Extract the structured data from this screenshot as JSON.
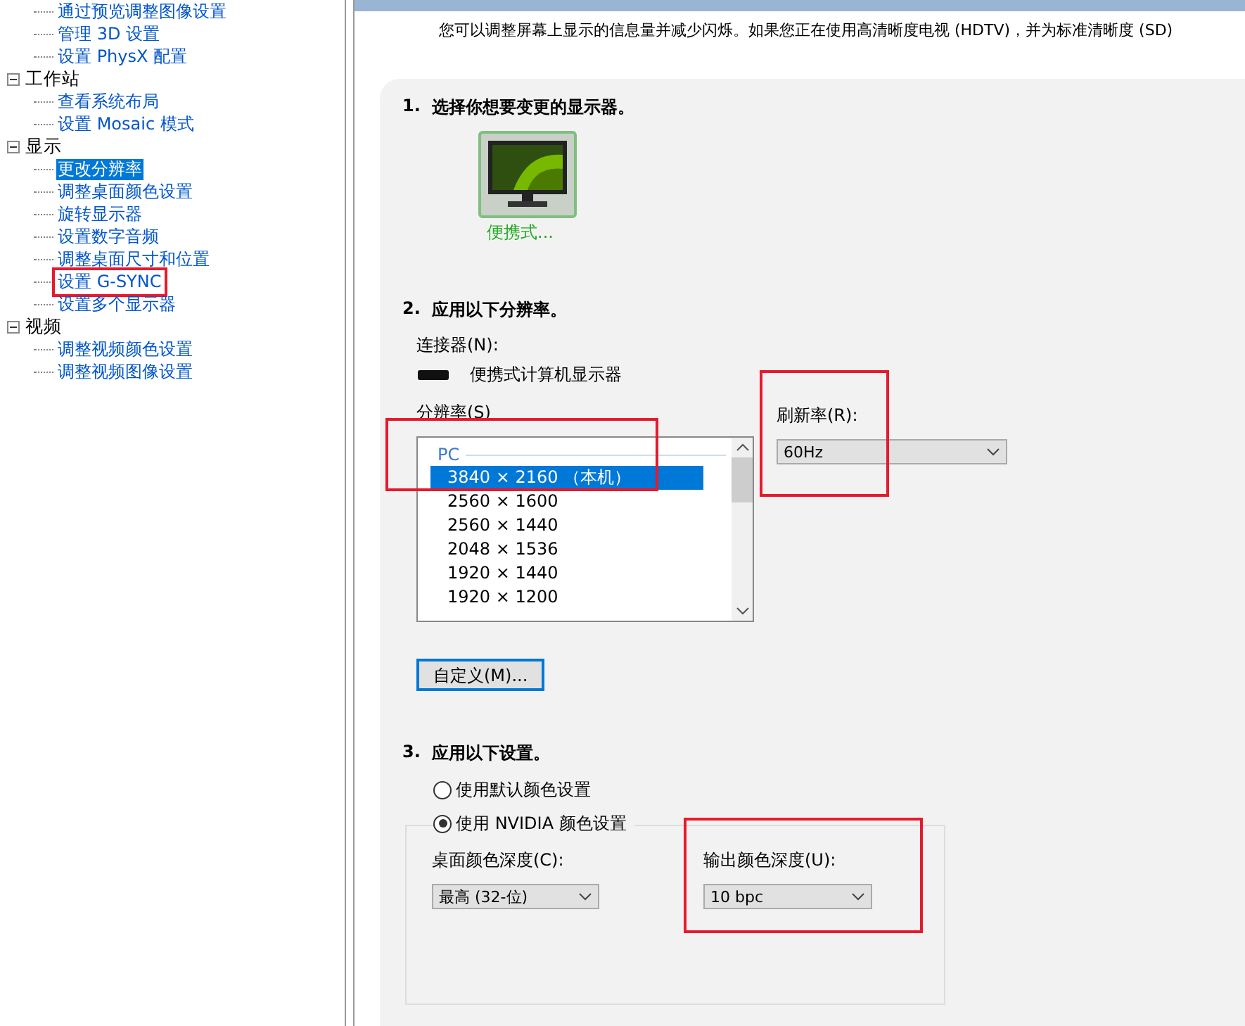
{
  "tree": {
    "continued_items": [
      {
        "label": "通过预览调整图像设置",
        "selected": false,
        "highlighted": false
      },
      {
        "label": "管理 3D 设置",
        "selected": false,
        "highlighted": false
      },
      {
        "label": "设置 PhysX 配置",
        "selected": false,
        "highlighted": false
      }
    ],
    "groups": [
      {
        "label": "工作站",
        "expanded": true,
        "children": [
          {
            "label": "查看系统布局",
            "selected": false,
            "highlighted": false
          },
          {
            "label": "设置 Mosaic 模式",
            "selected": false,
            "highlighted": false
          }
        ]
      },
      {
        "label": "显示",
        "expanded": true,
        "children": [
          {
            "label": "更改分辨率",
            "selected": true,
            "highlighted": false
          },
          {
            "label": "调整桌面颜色设置",
            "selected": false,
            "highlighted": false
          },
          {
            "label": "旋转显示器",
            "selected": false,
            "highlighted": false
          },
          {
            "label": "设置数字音频",
            "selected": false,
            "highlighted": false
          },
          {
            "label": "调整桌面尺寸和位置",
            "selected": false,
            "highlighted": false
          },
          {
            "label": "设置 G-SYNC",
            "selected": false,
            "highlighted": true
          },
          {
            "label": "设置多个显示器",
            "selected": false,
            "highlighted": false
          }
        ]
      },
      {
        "label": "视频",
        "expanded": true,
        "children": [
          {
            "label": "调整视频颜色设置",
            "selected": false,
            "highlighted": false
          },
          {
            "label": "调整视频图像设置",
            "selected": false,
            "highlighted": false
          }
        ]
      }
    ]
  },
  "description": "您可以调整屏幕上显示的信息量并减少闪烁。如果您正在使用高清晰度电视 (HDTV)，并为标准清晰度 (SD)",
  "step1": {
    "number": "1.",
    "title": "选择你想要变更的显示器。",
    "displays": [
      {
        "label": "便携式...",
        "selected": true
      }
    ]
  },
  "step2": {
    "number": "2.",
    "title": "应用以下分辨率。",
    "connector_label": "连接器(N):",
    "connector": "便携式计算机显示器",
    "resolution_label": "分辨率(S)",
    "resolution_group": "PC",
    "resolution_highlighted": true,
    "resolutions": [
      {
        "label": "3840 × 2160 （本机）",
        "selected": true
      },
      {
        "label": "2560 × 1600",
        "selected": false
      },
      {
        "label": "2560 × 1440",
        "selected": false
      },
      {
        "label": "2048 × 1536",
        "selected": false
      },
      {
        "label": "1920 × 1440",
        "selected": false
      },
      {
        "label": "1920 × 1200",
        "selected": false
      }
    ],
    "refresh_label": "刷新率(R):",
    "refresh_value": "60Hz",
    "refresh_highlighted": true,
    "custom_button": "自定义(M)..."
  },
  "step3": {
    "number": "3.",
    "title": "应用以下设置。",
    "options": [
      {
        "label": "使用默认颜色设置",
        "selected": false
      },
      {
        "label": "使用 NVIDIA 颜色设置",
        "selected": true
      }
    ],
    "desktop_depth_label": "桌面颜色深度(C):",
    "desktop_depth_value": "最高 (32-位)",
    "output_depth_label": "输出颜色深度(U):",
    "output_depth_value": "10 bpc",
    "output_highlighted": true
  }
}
